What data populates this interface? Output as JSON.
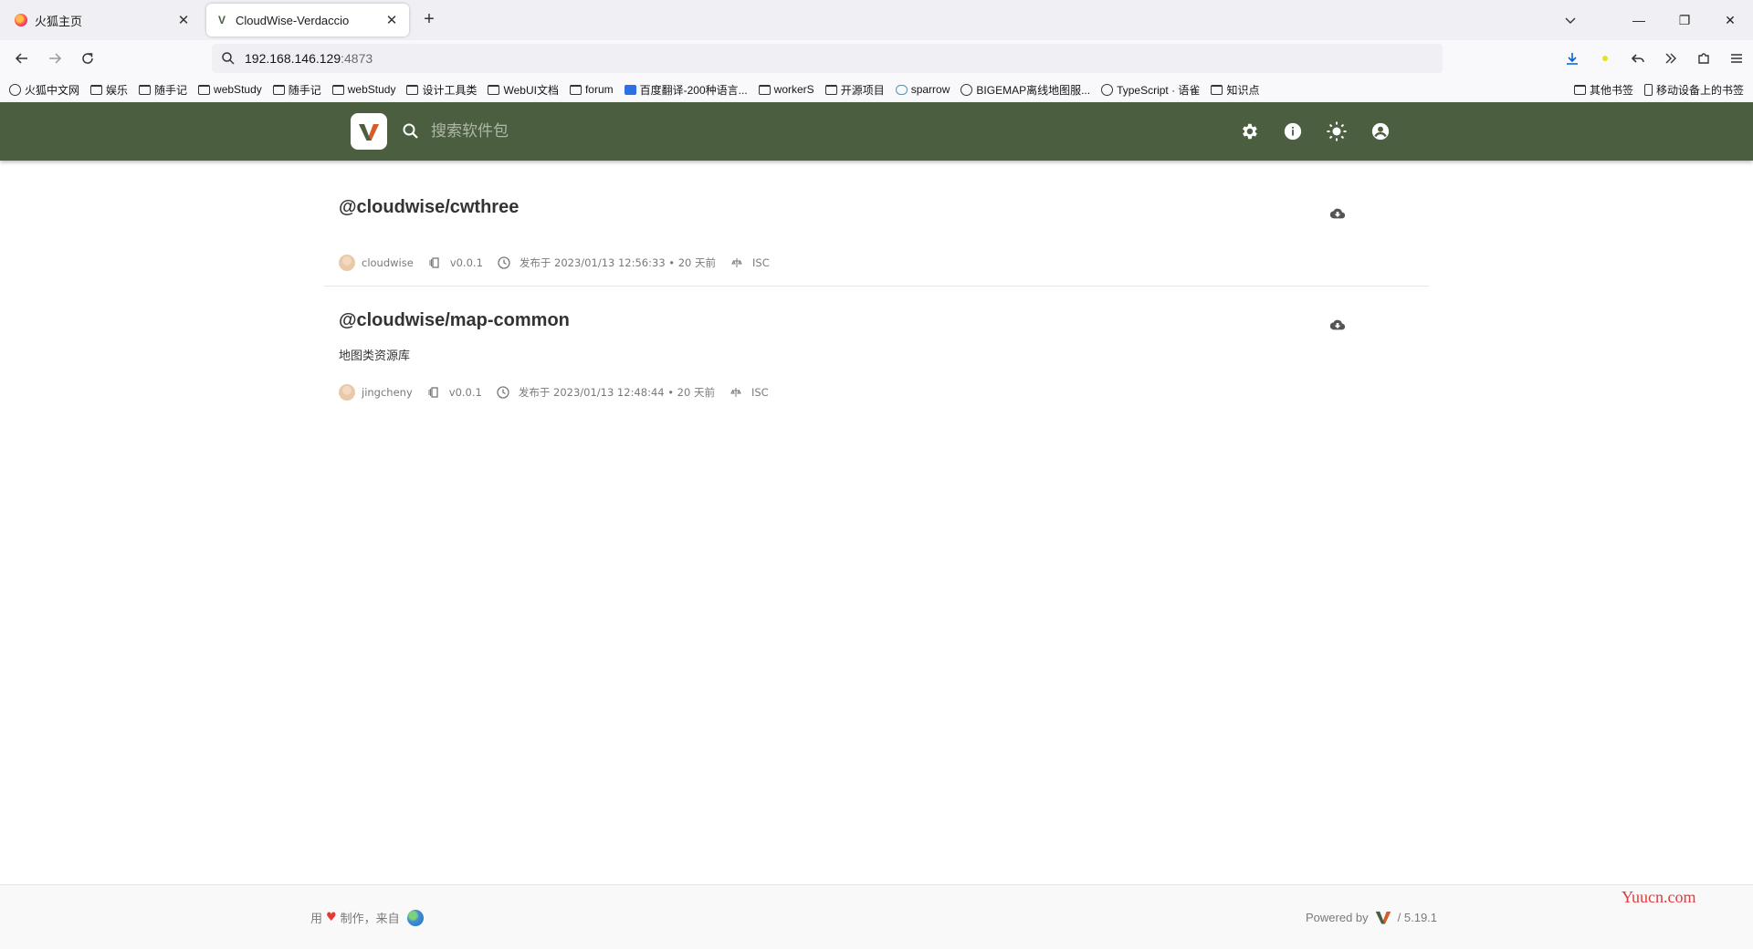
{
  "browser": {
    "tabs": [
      {
        "title": "火狐主页",
        "active": false
      },
      {
        "title": "CloudWise-Verdaccio",
        "active": true
      }
    ],
    "url": {
      "host": "192.168.146.129",
      "port": ":4873"
    },
    "bookmarks": [
      {
        "label": "火狐中文网",
        "icon": "globe-icon"
      },
      {
        "label": "娱乐",
        "icon": "folder-icon"
      },
      {
        "label": "随手记",
        "icon": "folder-icon"
      },
      {
        "label": "webStudy",
        "icon": "folder-icon"
      },
      {
        "label": "随手记",
        "icon": "folder-icon"
      },
      {
        "label": "webStudy",
        "icon": "folder-icon"
      },
      {
        "label": "设计工具类",
        "icon": "folder-icon"
      },
      {
        "label": "WebUI文档",
        "icon": "folder-icon"
      },
      {
        "label": "forum",
        "icon": "folder-icon"
      },
      {
        "label": "百度翻译-200种语言...",
        "icon": "translate-icon"
      },
      {
        "label": "workerS",
        "icon": "folder-icon"
      },
      {
        "label": "开源项目",
        "icon": "folder-icon"
      },
      {
        "label": "sparrow",
        "icon": "cloud-icon"
      },
      {
        "label": "BIGEMAP离线地图服...",
        "icon": "globe-icon"
      },
      {
        "label": "TypeScript · 语雀",
        "icon": "globe-icon"
      },
      {
        "label": "知识点",
        "icon": "folder-icon"
      }
    ],
    "bookmarks_right": [
      {
        "label": "其他书签",
        "icon": "folder-icon"
      },
      {
        "label": "移动设备上的书签",
        "icon": "mobile-icon"
      }
    ]
  },
  "app": {
    "search_placeholder": "搜索软件包",
    "accent": "#4b5e40",
    "packages": [
      {
        "name": "@cloudwise/cwthree",
        "description": "",
        "author": "cloudwise",
        "version": "v0.0.1",
        "published": "发布于 2023/01/13 12:56:33 • 20 天前",
        "license": "ISC"
      },
      {
        "name": "@cloudwise/map-common",
        "description": "地图类资源库",
        "author": "jingcheny",
        "version": "v0.0.1",
        "published": "发布于 2023/01/13 12:48:44 • 20 天前",
        "license": "ISC"
      }
    ],
    "footer": {
      "made_with_prefix": "用",
      "made_with_suffix": "制作，来自",
      "powered_by": "Powered by",
      "version": "/ 5.19.1"
    }
  },
  "watermark": "Yuucn.com"
}
